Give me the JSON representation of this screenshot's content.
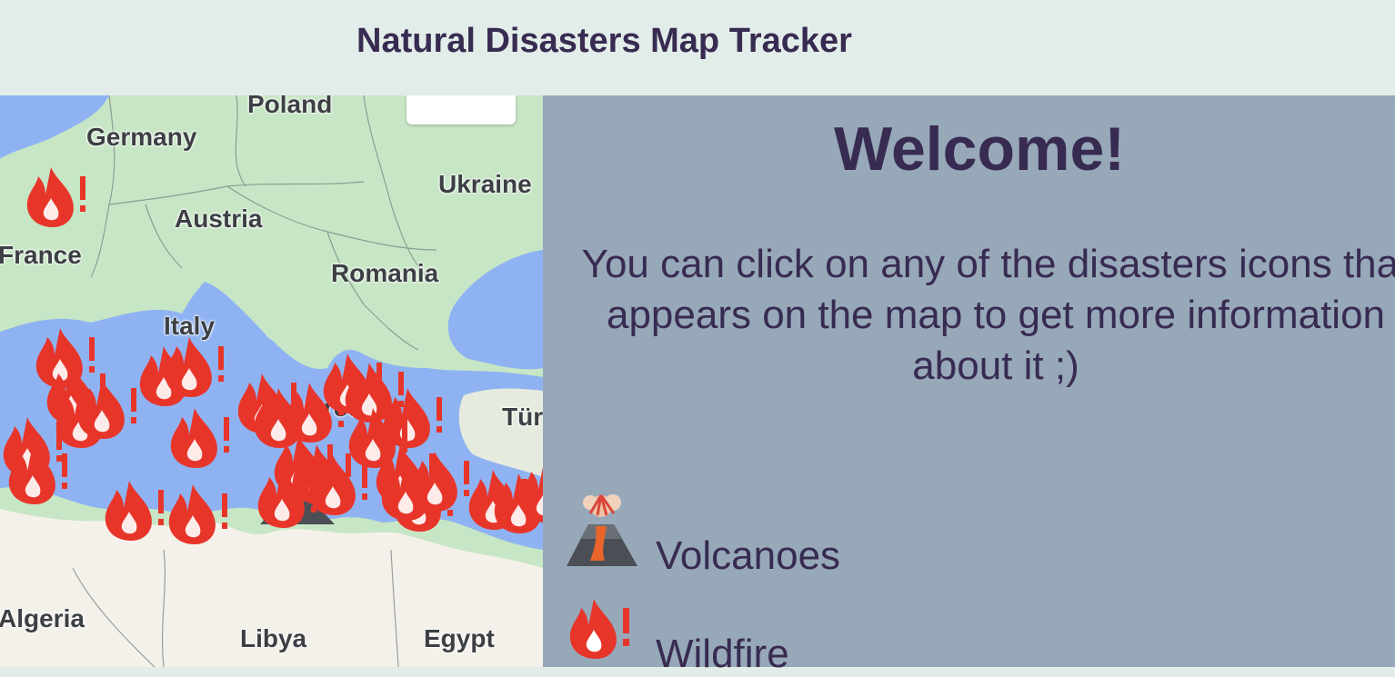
{
  "header": {
    "title": "Natural Disasters Map Tracker"
  },
  "map": {
    "countries": [
      "Poland",
      "Germany",
      "Ukraine",
      "Austria",
      "France",
      "Romania",
      "Italy",
      "Greece",
      "Türkiye",
      "Algeria",
      "Libya",
      "Egypt"
    ],
    "colors": {
      "land": "#c7e6c5",
      "water": "#8fb3f2",
      "desert": "#f4f1ea",
      "border": "#7e8b8a",
      "fire": "#e8352a"
    }
  },
  "panel": {
    "welcome": "Welcome!",
    "intro": "You can click on any of the disasters icons that appears on the map to get more information about it ;)",
    "legend": [
      {
        "icon": "volcano-icon",
        "label": "Volcanoes"
      },
      {
        "icon": "wildfire-icon",
        "label": "Wildfire"
      }
    ]
  }
}
